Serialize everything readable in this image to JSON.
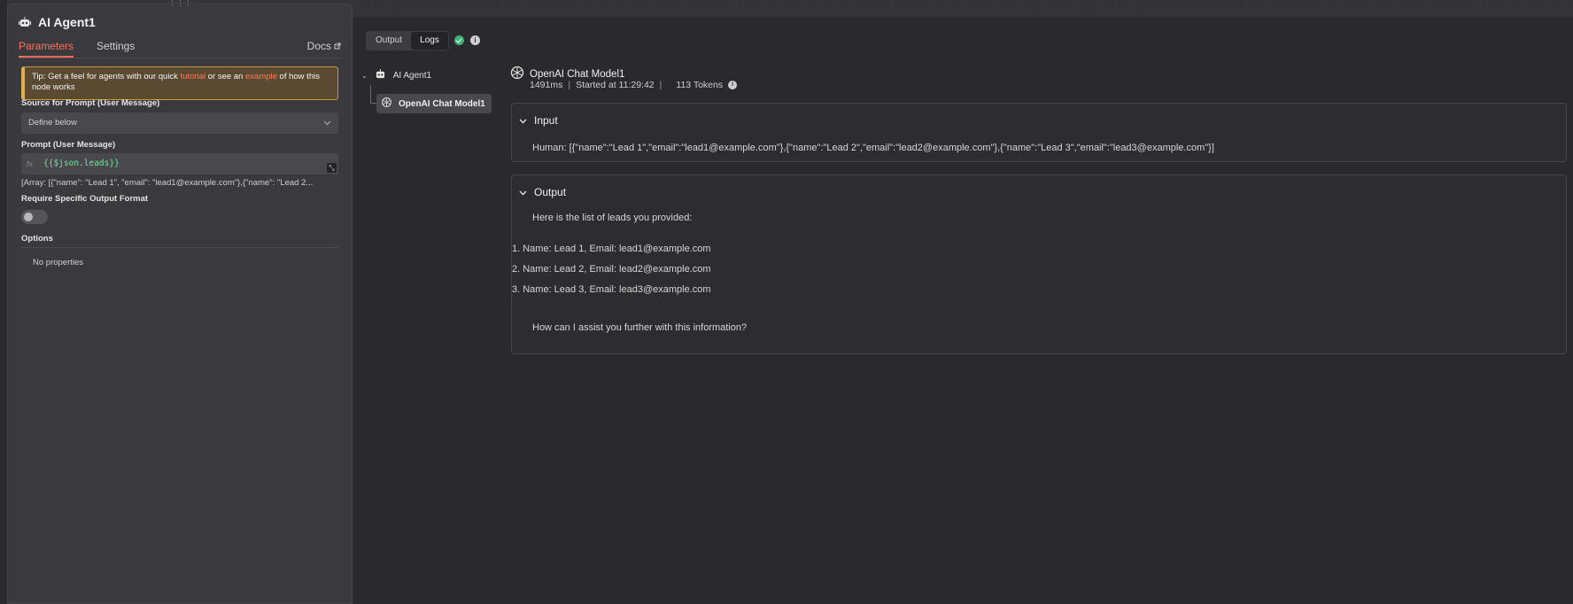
{
  "panel": {
    "title": "AI Agent1",
    "tabs": {
      "parameters": "Parameters",
      "settings": "Settings",
      "docs": "Docs"
    },
    "tip": {
      "prefix": "Tip: Get a feel for agents with our quick ",
      "link1": "tutorial",
      "middle": " or see an ",
      "link2": "example",
      "suffix": " of how this node works"
    },
    "source_label": "Source for Prompt (User Message)",
    "source_value": "Define below",
    "prompt_label": "Prompt (User Message)",
    "prompt_fx": "fx",
    "prompt_expression": "{{$json.leads}}",
    "prompt_preview": "[Array: [{\"name\": \"Lead 1\", \"email\": \"lead1@example.com\"},{\"name\": \"Lead 2...",
    "output_format_label": "Require Specific Output Format",
    "output_format_enabled": false,
    "options_label": "Options",
    "no_properties": "No properties"
  },
  "view_toggle": {
    "output": "Output",
    "logs": "Logs",
    "selected": "Logs"
  },
  "tree": {
    "agent": "AI Agent1",
    "model": "OpenAI Chat Model1"
  },
  "run": {
    "title": "OpenAI Chat Model1",
    "duration": "1491ms",
    "started": "Started at 11:29:42",
    "tokens": "113 Tokens"
  },
  "input_section": {
    "heading": "Input",
    "text": "Human: [{\"name\":\"Lead 1\",\"email\":\"lead1@example.com\"},{\"name\":\"Lead 2\",\"email\":\"lead2@example.com\"},{\"name\":\"Lead 3\",\"email\":\"lead3@example.com\"}]"
  },
  "output_section": {
    "heading": "Output",
    "intro": "Here is the list of leads you provided:",
    "items": [
      "1. Name: Lead 1, Email: lead1@example.com",
      "2. Name: Lead 2, Email: lead2@example.com",
      "3. Name: Lead 3, Email: lead3@example.com"
    ],
    "closing": "How can I assist you further with this information?"
  },
  "colors": {
    "accent": "#ff6d5a",
    "success": "#3cb371",
    "expression": "#6ee79a"
  }
}
